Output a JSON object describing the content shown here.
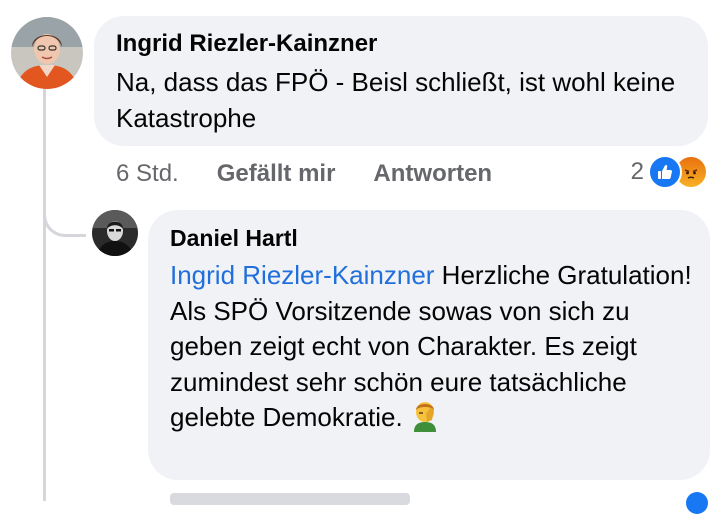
{
  "comment": {
    "author": "Ingrid Riezler-Kainzner",
    "text": "Na, dass das FPÖ - Beisl schließt, ist wohl keine Katastrophe",
    "time": "6 Std.",
    "like_label": "Gefällt mir",
    "reply_label": "Antworten",
    "reaction_count": "2",
    "reaction_icons": [
      "like-icon",
      "angry-icon"
    ]
  },
  "reply": {
    "author": "Daniel Hartl",
    "mention": "Ingrid Riezler-Kainzner",
    "text": " Herzliche Gratulation! Als SPÖ Vorsitzende sowas von sich zu geben zeigt echt von Charakter. Es zeigt zumindest sehr schön eure tatsächliche gelebte Demokratie.",
    "emoji": "facepalm-emoji"
  },
  "colors": {
    "bubble": "#f0f2f5",
    "mention": "#216fdb",
    "meta": "#65676b",
    "like": "#1877f2"
  }
}
